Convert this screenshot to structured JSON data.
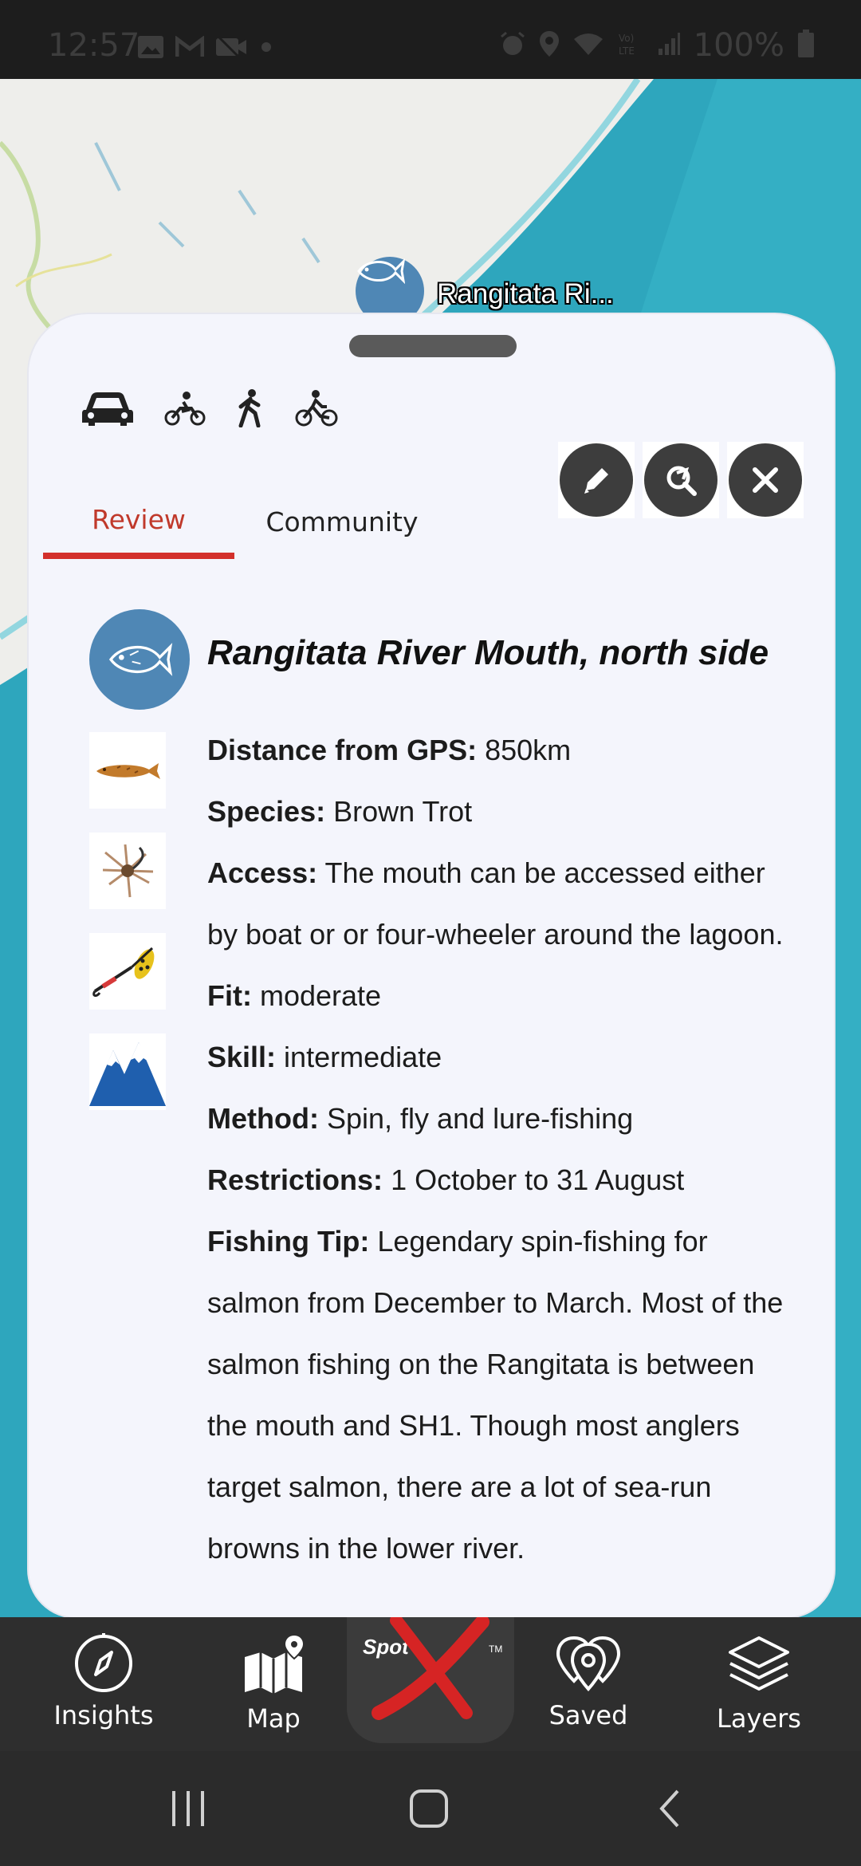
{
  "status_bar": {
    "time": "12:57",
    "battery": "100%",
    "left_icons": [
      "image-icon",
      "gmail-icon",
      "video-off-icon",
      "dot-icon"
    ],
    "right_icons": [
      "alarm-icon",
      "location-icon",
      "wifi-icon",
      "volte-icon",
      "signal-icon",
      "battery-icon"
    ]
  },
  "map": {
    "marker_label": "Rangitata Ri..."
  },
  "sheet": {
    "transport_icons": [
      "car-icon",
      "motorbike-icon",
      "walking-icon",
      "bicycle-icon"
    ],
    "actions": [
      "edit-icon",
      "search-route-icon",
      "close-icon"
    ],
    "tabs": [
      {
        "label": "Review",
        "active": true
      },
      {
        "label": "Community",
        "active": false
      }
    ],
    "title": "Rangitata River Mouth, north side",
    "details": {
      "distance": {
        "label": "Distance from GPS:",
        "value": "850km"
      },
      "species": {
        "label": "Species:",
        "value": "Brown Trot"
      },
      "access": {
        "label": "Access:",
        "value": "The mouth can be accessed either by boat or or four-wheeler around the lagoon."
      },
      "fit": {
        "label": "Fit:",
        "value": "moderate"
      },
      "skill": {
        "label": "Skill:",
        "value": "intermediate"
      },
      "method": {
        "label": "Method:",
        "value": "Spin, fly and lure-fishing"
      },
      "restrictions": {
        "label": "Restrictions:",
        "value": "1 October to 31 August"
      },
      "tip": {
        "label": "Fishing Tip:",
        "value": "Legendary spin-fishing for salmon from December to March. Most of the salmon fishing on the Rangitata is between the mouth and SH1. Though most anglers target salmon, there are a lot of sea-run browns in the lower river."
      }
    },
    "side_icons": [
      "trout-icon",
      "fly-lure-icon",
      "spinner-lure-icon",
      "mountain-icon"
    ]
  },
  "bottom_nav": {
    "items": [
      {
        "label": "Insights",
        "icon": "compass-icon"
      },
      {
        "label": "Map",
        "icon": "map-icon"
      },
      {
        "label": "Saved",
        "icon": "saved-pins-icon"
      },
      {
        "label": "Layers",
        "icon": "layers-icon"
      }
    ],
    "center": {
      "logo_text": "Spot",
      "trademark": "TM"
    }
  },
  "colors": {
    "accent_red": "#d3302b",
    "marker_blue": "#4f87b5",
    "water": "#2ea6bd",
    "sheet_bg": "#f4f5fc"
  }
}
